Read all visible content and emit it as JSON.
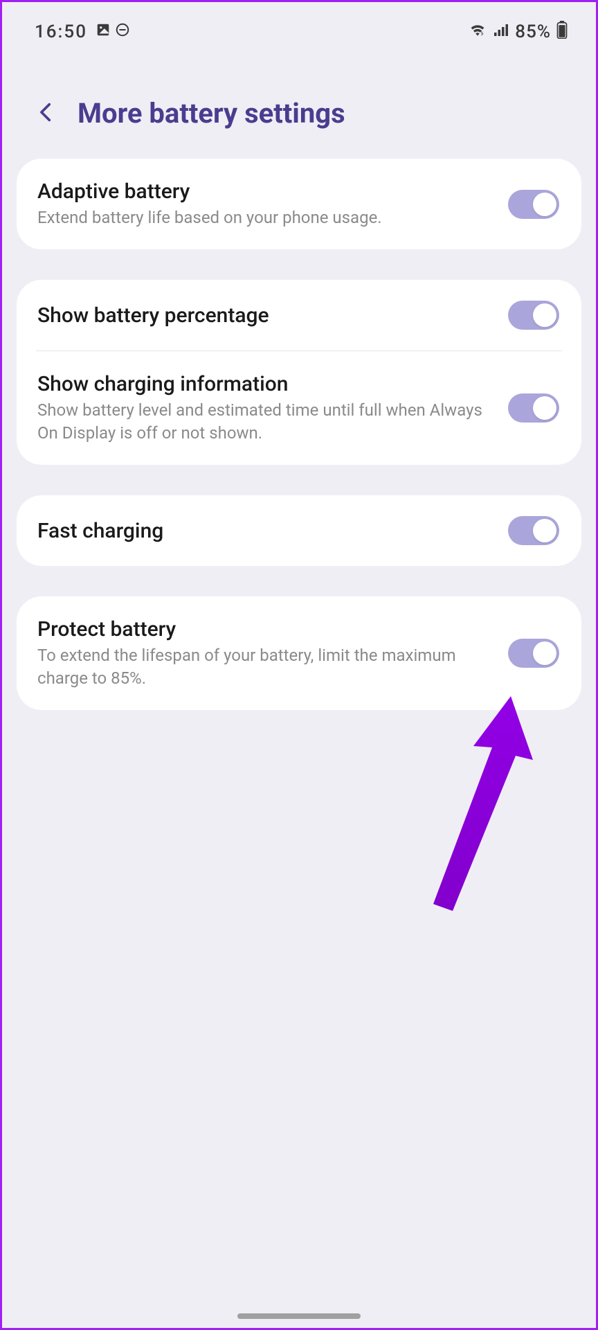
{
  "status": {
    "time": "16:50",
    "battery_text": "85%"
  },
  "header": {
    "title": "More battery settings"
  },
  "settings": {
    "adaptive": {
      "title": "Adaptive battery",
      "sub": "Extend battery life based on your phone usage.",
      "on": true
    },
    "percentage": {
      "title": "Show battery percentage",
      "on": true
    },
    "charging_info": {
      "title": "Show charging information",
      "sub": "Show battery level and estimated time until full when Always On Display is off or not shown.",
      "on": true
    },
    "fast_charging": {
      "title": "Fast charging",
      "on": true
    },
    "protect": {
      "title": "Protect battery",
      "sub": "To extend the lifespan of your battery, limit the maximum charge to 85%.",
      "on": true
    }
  }
}
